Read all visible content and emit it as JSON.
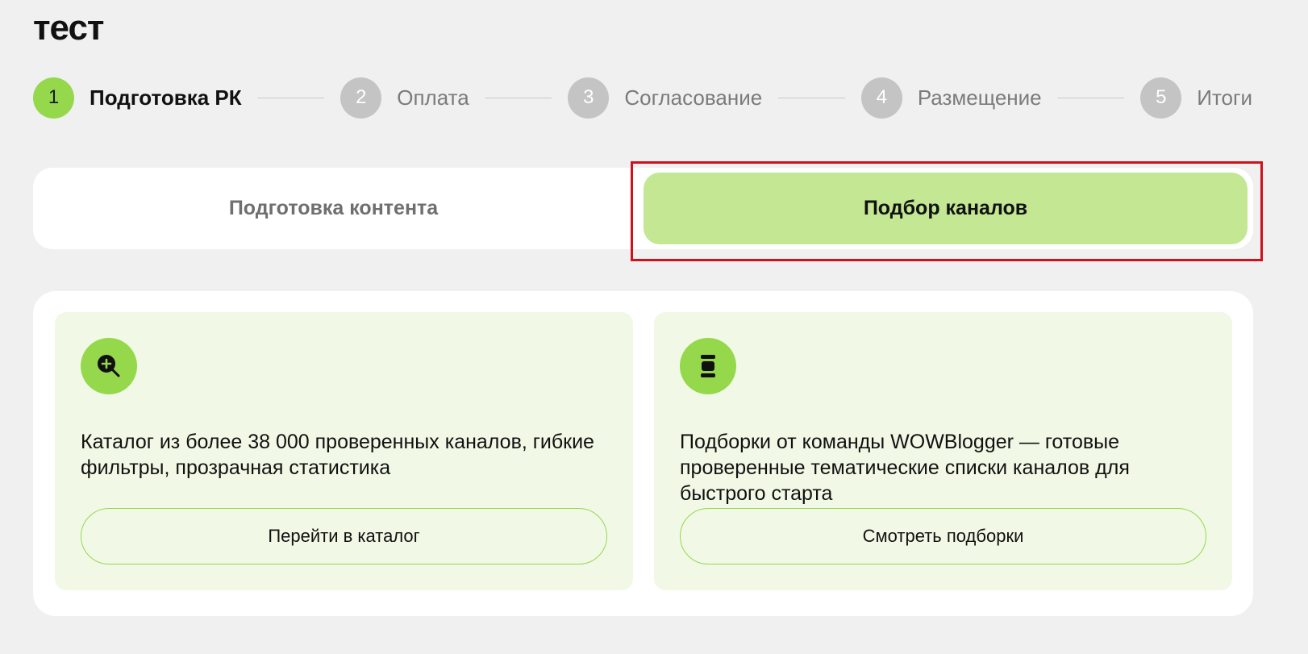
{
  "page": {
    "title": "тест"
  },
  "stepper": {
    "steps": [
      {
        "number": "1",
        "label": "Подготовка РК",
        "active": true
      },
      {
        "number": "2",
        "label": "Оплата",
        "active": false
      },
      {
        "number": "3",
        "label": "Согласование",
        "active": false
      },
      {
        "number": "4",
        "label": "Размещение",
        "active": false
      },
      {
        "number": "5",
        "label": "Итоги",
        "active": false
      }
    ]
  },
  "tabs": {
    "content_label": "Подготовка контента",
    "channels_label": "Подбор каналов",
    "selected": "channels"
  },
  "cards": [
    {
      "icon": "search-plus-icon",
      "text": "Каталог из более 38 000 проверенных каналов, гибкие фильтры, прозрачная статистика",
      "button_label": "Перейти в каталог"
    },
    {
      "icon": "collection-stack-icon",
      "text": "Подборки от команды WOWBlogger — готовые проверенные тематические списки каналов для быстрого старта",
      "button_label": "Смотреть подборки"
    }
  ],
  "colors": {
    "accent_green": "#95d84c",
    "selected_tab": "#c3e793",
    "card_bg": "#f1f9e6",
    "highlight_red": "#d0101a"
  }
}
